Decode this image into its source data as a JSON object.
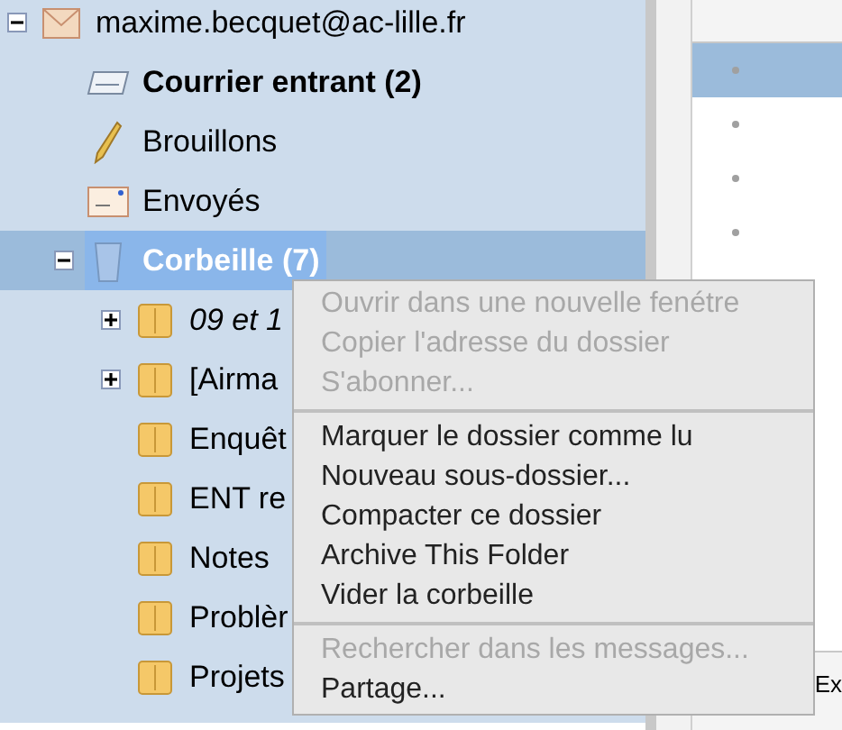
{
  "folder_tree": [
    {
      "label": "maxime.becquet@ac-lille.fr",
      "kind": "account",
      "bold": false,
      "italic": false,
      "selected": false,
      "expanded": true,
      "children": [
        {
          "label": "Courrier entrant (2)",
          "kind": "inbox",
          "bold": true,
          "italic": false,
          "selected": false
        },
        {
          "label": "Brouillons",
          "kind": "drafts",
          "bold": false,
          "italic": false,
          "selected": false
        },
        {
          "label": "Envoyés",
          "kind": "sent",
          "bold": false,
          "italic": false,
          "selected": false
        },
        {
          "label": "Corbeille (7)",
          "kind": "trash",
          "bold": true,
          "italic": false,
          "selected": true,
          "expanded": true,
          "children": [
            {
              "label": "09 et 1",
              "kind": "folder",
              "bold": false,
              "italic": true,
              "selected": false,
              "expanded": false
            },
            {
              "label": "[Airma",
              "kind": "folder",
              "bold": false,
              "italic": false,
              "selected": false,
              "expanded": false
            },
            {
              "label": "Enquêt",
              "kind": "folder",
              "bold": false,
              "italic": false,
              "selected": false
            },
            {
              "label": "ENT re",
              "kind": "folder",
              "bold": false,
              "italic": false,
              "selected": false
            },
            {
              "label": "Notes",
              "kind": "folder",
              "bold": false,
              "italic": false,
              "selected": false
            },
            {
              "label": "Problèr",
              "kind": "folder",
              "bold": false,
              "italic": false,
              "selected": false
            },
            {
              "label": "Projets",
              "kind": "folder",
              "bold": false,
              "italic": false,
              "selected": false
            }
          ]
        }
      ]
    }
  ],
  "message_rows": [
    {
      "selected": true
    },
    {
      "selected": false
    },
    {
      "selected": false
    },
    {
      "selected": false
    }
  ],
  "status_text": "Ex",
  "context_menu": [
    [
      {
        "label": "Ouvrir dans une nouvelle fenétre",
        "disabled": true
      },
      {
        "label": "Copier l'adresse du dossier",
        "disabled": true
      },
      {
        "label": "S'abonner...",
        "disabled": true
      }
    ],
    [
      {
        "label": "Marquer le dossier comme lu",
        "disabled": false
      },
      {
        "label": "Nouveau sous-dossier...",
        "disabled": false
      },
      {
        "label": "Compacter ce dossier",
        "disabled": false
      },
      {
        "label": "Archive This Folder",
        "disabled": false
      },
      {
        "label": "Vider la corbeille",
        "disabled": false
      }
    ],
    [
      {
        "label": "Rechercher dans les messages...",
        "disabled": true
      },
      {
        "label": "Partage...",
        "disabled": false
      }
    ]
  ]
}
